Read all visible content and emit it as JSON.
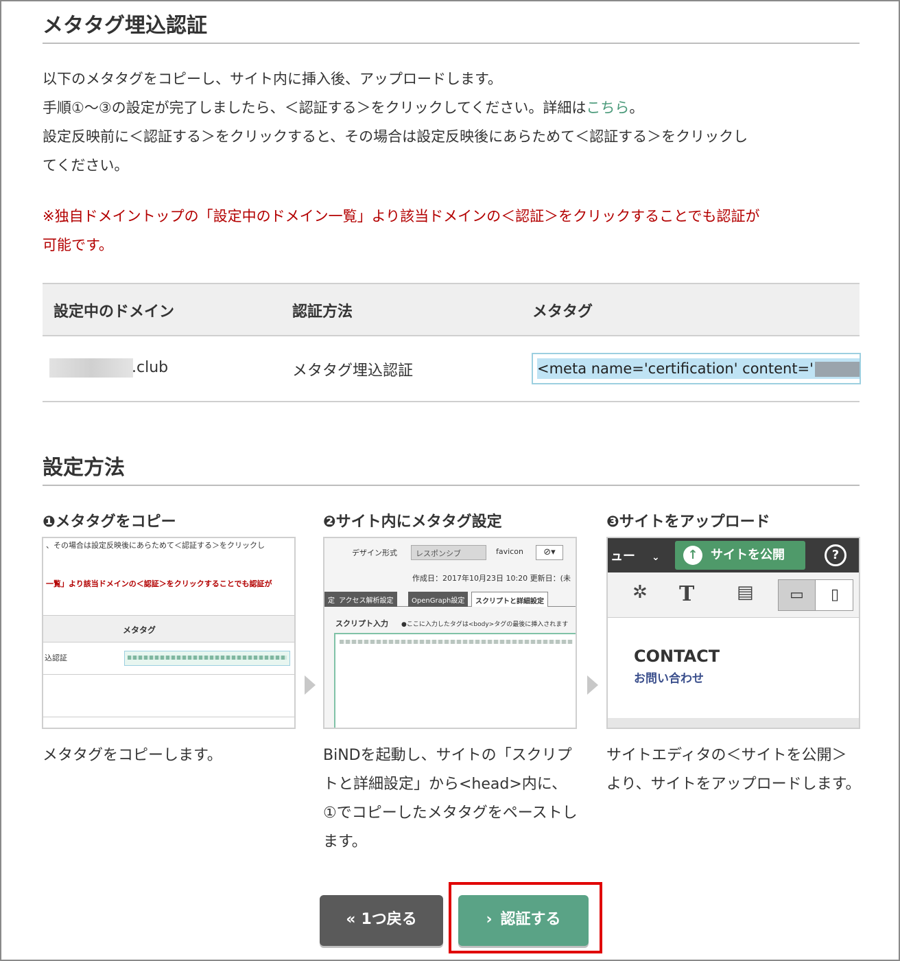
{
  "section1": {
    "title": "メタタグ埋込認証",
    "line1": "以下のメタタグをコピーし、サイト内に挿入後、アップロードします。",
    "line2_pre": "手順①〜③の設定が完了しましたら、＜認証する＞をクリックしてください。詳細は",
    "line2_link": "こちら",
    "line2_post": "。",
    "line3": "設定反映前に＜認証する＞をクリックすると、その場合は設定反映後にあらためて＜認証する＞をクリックし",
    "line4": "てください。",
    "note1": "※独自ドメイントップの「設定中のドメイン一覧」より該当ドメインの＜認証＞をクリックすることでも認証が",
    "note2": "可能です。"
  },
  "table": {
    "headers": [
      "設定中のドメイン",
      "認証方法",
      "メタタグ"
    ],
    "domain_suffix": ".club",
    "method": "メタタグ埋込認証",
    "metatag": "<meta name='certification' content='"
  },
  "section2": {
    "title": "設定方法",
    "steps": [
      {
        "title": "❶メタタグをコピー",
        "desc": "メタタグをコピーします。"
      },
      {
        "title": "❷サイト内にメタタグ設定",
        "desc": "BiNDを起動し、サイトの「スクリプトと詳細設定」から<head>内に、①でコピーしたメタタグをペーストします。"
      },
      {
        "title": "❸サイトをアップロード",
        "desc": "サイトエディタの＜サイトを公開＞より、サイトをアップロードします。"
      }
    ]
  },
  "shot1": {
    "line_a": "、その場合は設定反映後にあらためて＜認証する＞をクリックし",
    "line_b": "一覧」より該当ドメインの＜認証＞をクリックすることでも認証が",
    "th": "メタタグ",
    "td": "込認証"
  },
  "shot2": {
    "design_label": "デザイン形式",
    "select_value": "レスポンシブ",
    "favicon_label": "favicon",
    "created": "作成日：2017年10月23日 10:20 更新日：(未",
    "tabs": [
      "定",
      "アクセス解析設定",
      "OpenGraph設定",
      "スクリプトと詳細設定"
    ],
    "script_label": "スクリプト入力",
    "script_note": "●ここに入力したタグは<body>タグの最後に挿入されます"
  },
  "shot3": {
    "menu": "ュー",
    "publish": "サイトを公開",
    "contact": "CONTACT",
    "contact_jp": "お問い合わせ"
  },
  "buttons": {
    "back": "1つ戻る",
    "auth": "認証する"
  },
  "colors": {
    "link": "#4a9a7a",
    "note": "#b30000",
    "auth_button": "#5aa386",
    "back_button": "#5a5a5a",
    "highlight": "#e00000"
  }
}
